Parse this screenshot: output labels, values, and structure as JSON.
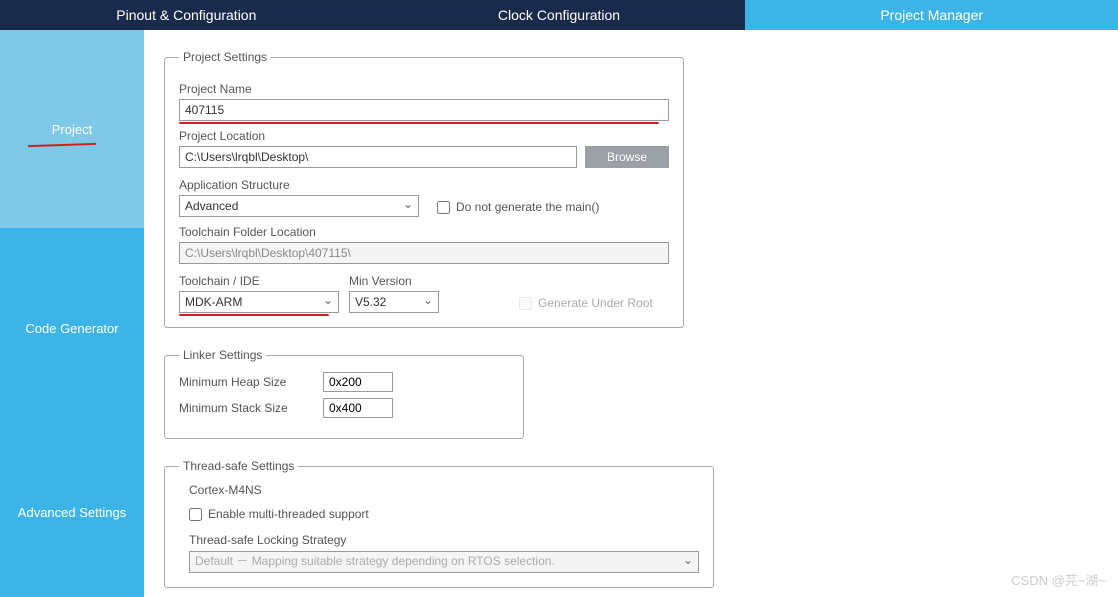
{
  "tabs": {
    "pinout": "Pinout & Configuration",
    "clock": "Clock Configuration",
    "project_mgr": "Project Manager"
  },
  "sidebar": {
    "project": "Project",
    "code_gen": "Code Generator",
    "advanced": "Advanced Settings"
  },
  "project_settings": {
    "legend": "Project Settings",
    "name_label": "Project Name",
    "name_value": "407115",
    "location_label": "Project Location",
    "location_value": "C:\\Users\\lrqbl\\Desktop\\",
    "browse": "Browse",
    "app_struct_label": "Application Structure",
    "app_struct_value": "Advanced",
    "no_main_label": "Do not generate the main()",
    "toolchain_folder_label": "Toolchain Folder Location",
    "toolchain_folder_value": "C:\\Users\\lrqbl\\Desktop\\407115\\",
    "toolchain_ide_label": "Toolchain / IDE",
    "toolchain_ide_value": "MDK-ARM",
    "min_version_label": "Min Version",
    "min_version_value": "V5.32",
    "gen_under_root_label": "Generate Under Root"
  },
  "linker": {
    "legend": "Linker Settings",
    "heap_label": "Minimum Heap Size",
    "heap_value": "0x200",
    "stack_label": "Minimum Stack Size",
    "stack_value": "0x400"
  },
  "threadsafe": {
    "legend": "Thread-safe Settings",
    "core": "Cortex-M4NS",
    "enable_label": "Enable multi-threaded support",
    "strategy_label": "Thread-safe Locking Strategy",
    "strategy_value": "Default － Mapping suitable strategy depending on RTOS selection."
  },
  "watermark": "CSDN @芫~湖~"
}
